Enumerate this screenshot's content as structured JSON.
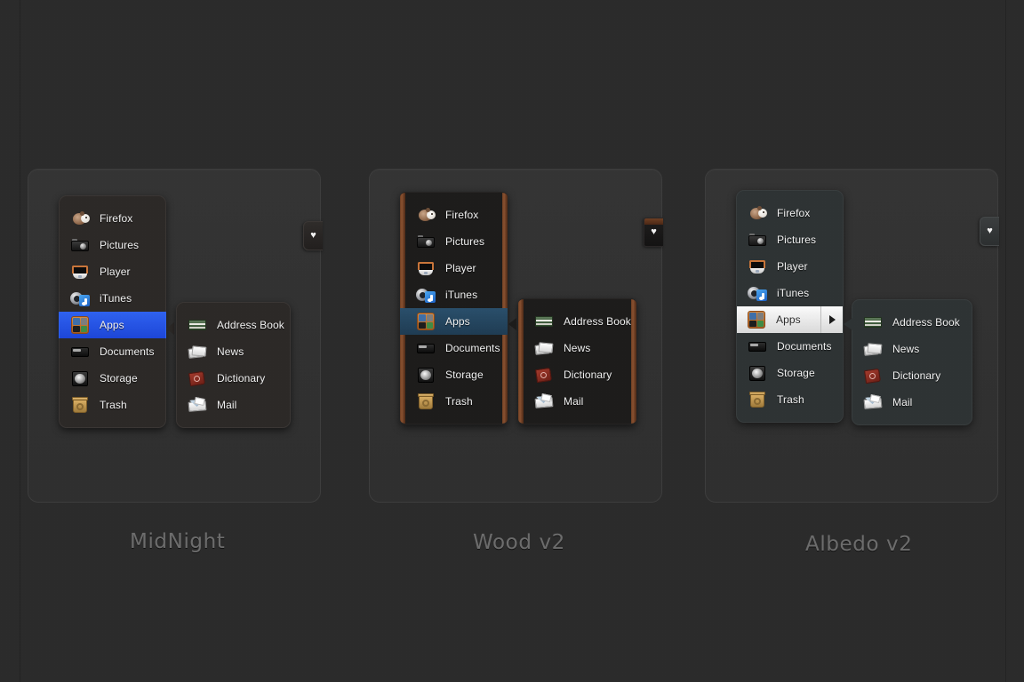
{
  "page": {
    "title": "Theme preview sheet"
  },
  "themes": [
    {
      "id": "midnight",
      "label": "MidNight",
      "accent": "#2f62f0",
      "menu_bg": "#2c2927",
      "text_color": "#f0f0f0",
      "selected_item": "Apps",
      "heart_tab": {
        "glyph": "♥",
        "name": "favorites-tab"
      },
      "main_menu": [
        {
          "label": "Firefox",
          "icon": "firefox-icon"
        },
        {
          "label": "Pictures",
          "icon": "camera-icon"
        },
        {
          "label": "Player",
          "icon": "media-player-icon"
        },
        {
          "label": "iTunes",
          "icon": "itunes-icon"
        },
        {
          "label": "Apps",
          "icon": "apps-grid-icon"
        },
        {
          "label": "Documents",
          "icon": "documents-icon"
        },
        {
          "label": "Storage",
          "icon": "hard-drive-icon"
        },
        {
          "label": "Trash",
          "icon": "trash-icon"
        }
      ],
      "submenu": [
        {
          "label": "Address Book",
          "icon": "green-book-icon"
        },
        {
          "label": "News",
          "icon": "newspaper-icon"
        },
        {
          "label": "Dictionary",
          "icon": "red-book-icon"
        },
        {
          "label": "Mail",
          "icon": "envelope-icon"
        }
      ]
    },
    {
      "id": "wood",
      "label": "Wood v2",
      "accent": "#2a4f6b",
      "menu_bg": "#1d1c1b",
      "wood_color": "#8a5130",
      "text_color": "#f0f0f0",
      "selected_item": "Apps",
      "heart_tab": {
        "glyph": "♥",
        "name": "favorites-tab"
      },
      "main_menu": [
        {
          "label": "Firefox",
          "icon": "firefox-icon"
        },
        {
          "label": "Pictures",
          "icon": "camera-icon"
        },
        {
          "label": "Player",
          "icon": "media-player-icon"
        },
        {
          "label": "iTunes",
          "icon": "itunes-icon"
        },
        {
          "label": "Apps",
          "icon": "apps-grid-icon"
        },
        {
          "label": "Documents",
          "icon": "documents-icon"
        },
        {
          "label": "Storage",
          "icon": "hard-drive-icon"
        },
        {
          "label": "Trash",
          "icon": "trash-icon"
        }
      ],
      "submenu": [
        {
          "label": "Address Book",
          "icon": "green-book-icon"
        },
        {
          "label": "News",
          "icon": "newspaper-icon"
        },
        {
          "label": "Dictionary",
          "icon": "red-book-icon"
        },
        {
          "label": "Mail",
          "icon": "envelope-icon"
        }
      ]
    },
    {
      "id": "albedo",
      "label": "Albedo v2",
      "accent": "#f0f0f0",
      "menu_bg": "#2e3334",
      "text_color": "#f0f0f0",
      "selected_item": "Apps",
      "selected_text_color": "#2a2a2a",
      "submenu_arrow": "▶",
      "heart_tab": {
        "glyph": "♥",
        "name": "favorites-tab"
      },
      "main_menu": [
        {
          "label": "Firefox",
          "icon": "firefox-icon"
        },
        {
          "label": "Pictures",
          "icon": "camera-icon"
        },
        {
          "label": "Player",
          "icon": "media-player-icon"
        },
        {
          "label": "iTunes",
          "icon": "itunes-icon"
        },
        {
          "label": "Apps",
          "icon": "apps-grid-icon"
        },
        {
          "label": "Documents",
          "icon": "documents-icon"
        },
        {
          "label": "Storage",
          "icon": "hard-drive-icon"
        },
        {
          "label": "Trash",
          "icon": "trash-icon"
        }
      ],
      "submenu": [
        {
          "label": "Address Book",
          "icon": "green-book-icon"
        },
        {
          "label": "News",
          "icon": "newspaper-icon"
        },
        {
          "label": "Dictionary",
          "icon": "red-book-icon"
        },
        {
          "label": "Mail",
          "icon": "envelope-icon"
        }
      ]
    }
  ]
}
